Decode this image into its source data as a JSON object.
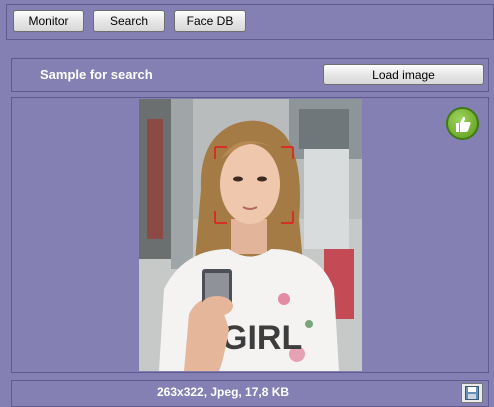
{
  "toolbar": {
    "monitor_label": "Monitor",
    "search_label": "Search",
    "face_db_label": "Face DB"
  },
  "sample": {
    "title": "Sample for search",
    "load_button_label": "Load image"
  },
  "preview": {
    "image_description_text": "GIRL",
    "face_detected_icon": "thumbs-up-icon"
  },
  "status": {
    "image_info": "263x322, Jpeg, 17,8 KB",
    "save_icon": "save-icon"
  },
  "colors": {
    "background": "#8480b3",
    "face_box": "#e21b1b",
    "badge_green": "#6bb02a"
  }
}
